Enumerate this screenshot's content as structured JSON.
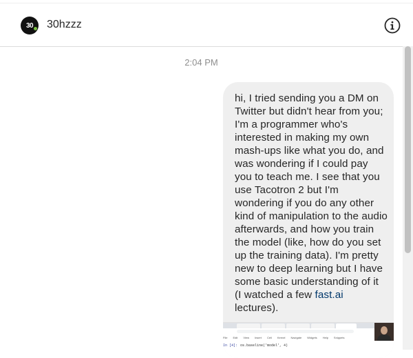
{
  "header": {
    "avatar_text": "30",
    "username": "30hzzz",
    "info_icon": "info-icon"
  },
  "thread": {
    "timestamp": "2:04 PM",
    "message": {
      "text_before_link": "hi, I tried sending you a DM on Twitter but didn't hear from you; I'm a programmer who's interested in making my own mash-ups like what you do, and was wondering if I could pay you to teach me. I see that you use Tacotron 2 but I'm wondering if you do any other kind of manipulation to the audio afterwards, and how you train the model (like, how do you set up the training data). I'm pretty new to deep learning but I have some basic understanding of it (I watched a few ",
      "link_text": "fast.ai",
      "text_after_link": " lectures)."
    },
    "attachment": {
      "menu_items": [
        "File",
        "Edit",
        "View",
        "Insert",
        "Cell",
        "Kernel",
        "Navigate",
        "Widgets",
        "Help",
        "Snippets"
      ],
      "cell_prompt": "In [4]:",
      "cell_code": "os.baseline('model', 4)"
    }
  },
  "colors": {
    "bubble_bg": "#efefef",
    "link": "#00376b",
    "timestamp": "#8e8e8e"
  }
}
